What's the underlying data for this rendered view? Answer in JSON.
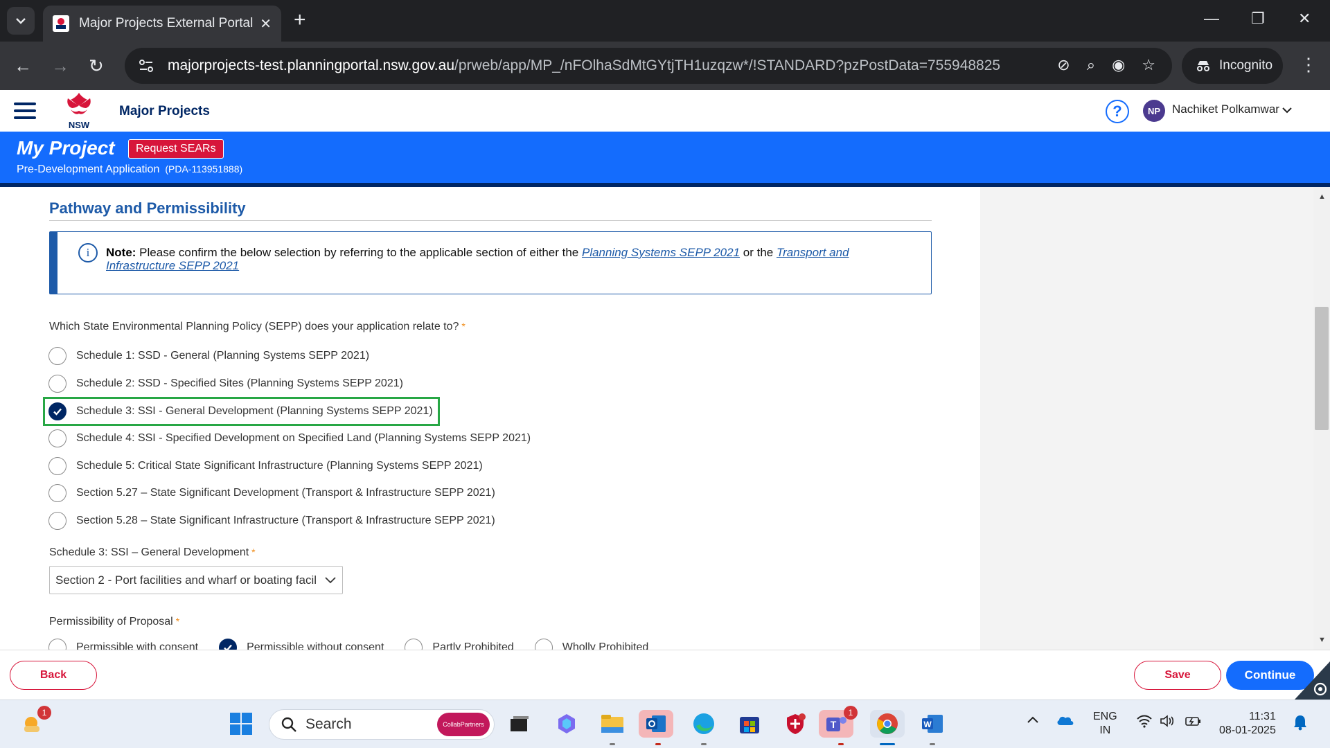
{
  "browser": {
    "tab_title": "Major Projects External Portal",
    "url_host": "majorprojects-test.planningportal.nsw.gov.au",
    "url_path": "/prweb/app/MP_/nFOlhaSdMtGYtjTH1uzqzw*/!STANDARD?pzPostData=755948825",
    "incognito_label": "Incognito"
  },
  "header": {
    "logo_text": "NSW",
    "brand": "Major Projects",
    "user_initials": "NP",
    "user_name": "Nachiket Polkamwar"
  },
  "banner": {
    "title": "My Project",
    "request_button": "Request SEARs",
    "subtitle": "Pre-Development Application",
    "pda_id": "(PDA-113951888)"
  },
  "section": {
    "title": "Pathway and Permissibility",
    "note_label": "Note:",
    "note_text_1": " Please confirm the below selection by referring to the applicable section of either the ",
    "note_link_1": "Planning Systems SEPP 2021",
    "note_text_2": " or the ",
    "note_link_2": "Transport and Infrastructure SEPP 2021"
  },
  "sepp_question": {
    "label": "Which State Environmental Planning Policy (SEPP) does your application relate to?",
    "required_mark": "*",
    "options": [
      {
        "label": "Schedule 1: SSD - General (Planning Systems SEPP 2021)",
        "checked": false
      },
      {
        "label": "Schedule 2: SSD - Specified Sites (Planning Systems SEPP 2021)",
        "checked": false
      },
      {
        "label": "Schedule 3: SSI - General Development (Planning Systems SEPP 2021)",
        "checked": true
      },
      {
        "label": "Schedule 4: SSI - Specified Development on Specified Land (Planning Systems SEPP 2021)",
        "checked": false
      },
      {
        "label": "Schedule 5: Critical State Significant Infrastructure (Planning Systems SEPP 2021)",
        "checked": false
      },
      {
        "label": "Section 5.27 – State Significant Development (Transport & Infrastructure SEPP 2021)",
        "checked": false
      },
      {
        "label": "Section 5.28 – State Significant Infrastructure (Transport & Infrastructure SEPP 2021)",
        "checked": false
      }
    ]
  },
  "schedule3": {
    "label": "Schedule 3: SSI – General Development",
    "required_mark": "*",
    "selected_value": "Section 2 - Port facilities and wharf or boating facil"
  },
  "permissibility": {
    "label": "Permissibility of Proposal",
    "required_mark": "*",
    "options": [
      {
        "label": "Permissible with consent",
        "checked": false
      },
      {
        "label": "Permissible without consent",
        "checked": true
      },
      {
        "label": "Partly Prohibited",
        "checked": false
      },
      {
        "label": "Wholly Prohibited",
        "checked": false
      }
    ]
  },
  "footer": {
    "back_label": "Back",
    "save_label": "Save",
    "continue_label": "Continue"
  },
  "taskbar": {
    "search_placeholder": "Search",
    "collab_label": "CollabPartners",
    "weather_badge": "1",
    "teams_badge": "1",
    "lang_1": "ENG",
    "lang_2": "IN",
    "time": "11:31",
    "date": "08-01-2025"
  },
  "colors": {
    "nsw_blue": "#146cfd",
    "nsw_navy": "#002664",
    "nsw_red": "#d7153a",
    "highlight_green": "#28a745"
  }
}
